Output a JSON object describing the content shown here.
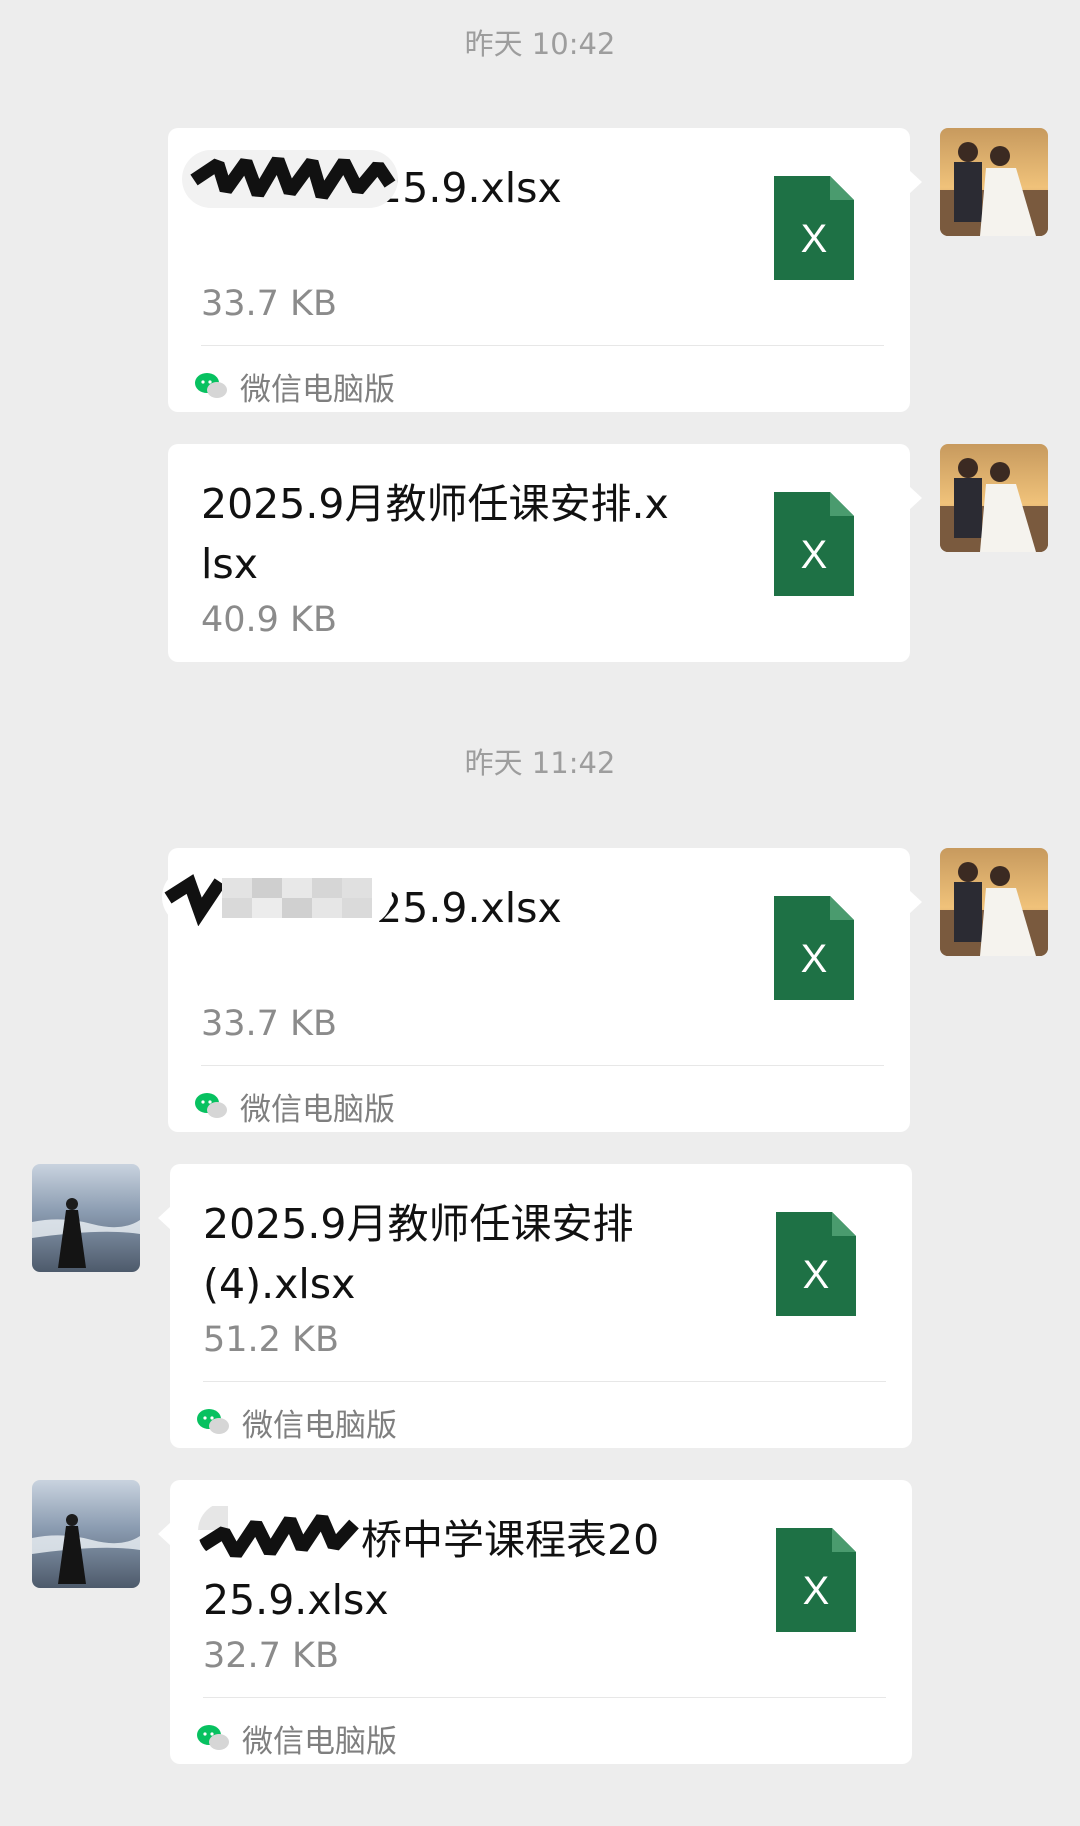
{
  "timestamps": [
    "昨天 10:42",
    "昨天 11:42"
  ],
  "messages": [
    {
      "name": "课程表2025.9.xlsx",
      "size": "33.7 KB",
      "source": "微信电脑版"
    },
    {
      "name": "2025.9月教师任课安排.xlsx",
      "size": "40.9 KB"
    },
    {
      "name": "课程表2025.9.xlsx",
      "size": "33.7 KB",
      "source": "微信电脑版"
    },
    {
      "name": "2025.9月教师任课安排(4).xlsx",
      "size": "51.2 KB",
      "source": "微信电脑版"
    },
    {
      "name": "桥中学课程表2025.9.xlsx",
      "size": "32.7 KB",
      "source": "微信电脑版"
    }
  ],
  "icons": {
    "file": "excel-file-icon",
    "source": "wechat-icon",
    "file_letter": "X"
  },
  "colors": {
    "excel_green": "#1e7145",
    "wechat_green": "#07c160",
    "background": "#ededed"
  }
}
